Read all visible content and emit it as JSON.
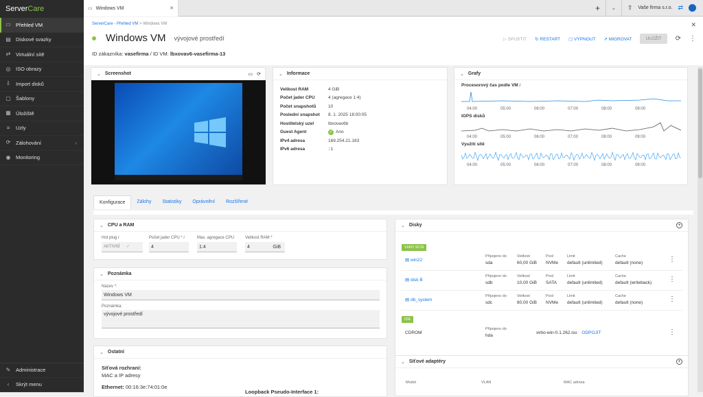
{
  "brand": {
    "part1": "Server",
    "part2": "Care"
  },
  "sidebar": {
    "items": [
      {
        "label": "Přehled VM",
        "icon": "monitor-icon"
      },
      {
        "label": "Diskové svazky",
        "icon": "disk-icon"
      },
      {
        "label": "Virtuální sítě",
        "icon": "network-icon"
      },
      {
        "label": "ISO obrazy",
        "icon": "iso-icon"
      },
      {
        "label": "Import disků",
        "icon": "import-icon"
      },
      {
        "label": "Šablony",
        "icon": "template-icon"
      },
      {
        "label": "Úložiště",
        "icon": "storage-icon"
      },
      {
        "label": "Uzly",
        "icon": "nodes-icon"
      },
      {
        "label": "Zálohování",
        "icon": "backup-icon"
      },
      {
        "label": "Monitoring",
        "icon": "monitoring-icon"
      }
    ],
    "bottom": [
      {
        "label": "Administrace",
        "icon": "wrench-icon"
      },
      {
        "label": "Skrýt menu",
        "icon": "chevron-left-icon"
      }
    ]
  },
  "topbar": {
    "tab_label": "Windows VM",
    "company": "Vaše firma s.r.o."
  },
  "header": {
    "breadcrumb_root": "ServerCare - Přehled VM",
    "breadcrumb_current": "Windows VM",
    "vm_name": "Windows VM",
    "vm_desc": "vývojové prostředí",
    "actions": {
      "start": "SPUSTIT",
      "restart": "RESTART",
      "stop": "VYPNOUT",
      "migrate": "MIGROVAT",
      "save": "ULOŽIT"
    },
    "id_label": "ID zákazníka:",
    "customer_id": "vasefirma",
    "vm_id_label": "ID VM:",
    "vm_id": "lbxovav6-vasefirma-13"
  },
  "screenshot_panel": {
    "title": "Screenshot"
  },
  "info_panel": {
    "title": "Informace",
    "rows": [
      {
        "k": "Velikost RAM",
        "v": "4 GiB"
      },
      {
        "k": "Počet jader CPU",
        "v": "4  (agregace  1:4)"
      },
      {
        "k": "Počet snapshotů",
        "v": "10"
      },
      {
        "k": "Poslední snapshot",
        "v": "8. 1. 2025 18:00:05"
      },
      {
        "k": "Hostitelský uzel",
        "v": "lbxovav6b"
      },
      {
        "k": "Guest Agent",
        "v": "Ano"
      },
      {
        "k": "IPv4 adresa",
        "v": "169.254.21.183"
      },
      {
        "k": "IPv6 adresa",
        "v": "::1"
      }
    ]
  },
  "graphs_panel": {
    "title": "Grafy",
    "charts": [
      {
        "title": "Procesorový čas podle VM"
      },
      {
        "title": "IOPS disků"
      },
      {
        "title": "Využití sítě"
      }
    ],
    "x_ticks": [
      "04:00",
      "05:00",
      "06:00",
      "07:00",
      "08:00",
      "09:00"
    ]
  },
  "tabs": [
    "Konfigurace",
    "Zálohy",
    "Statistiky",
    "Oprávnění",
    "Rozšířené"
  ],
  "cpu_panel": {
    "title": "CPU a RAM",
    "hotplug_label": "Hot plug",
    "hotplug_value": "AKTIVNÍ",
    "cores_label": "Počet jader CPU",
    "cores_value": "4",
    "agg_label": "Max. agregace CPU",
    "agg_value": "1:4",
    "ram_label": "Velikost RAM",
    "ram_value": "4",
    "ram_unit": "GiB"
  },
  "note_panel": {
    "title": "Poznámka",
    "name_label": "Název",
    "name_value": "Windows VM",
    "note_label": "Poznámka:",
    "note_value": "vývojové prostředí"
  },
  "other_panel": {
    "title": "Ostatní",
    "net_label": "Síťová rozhraní:",
    "net_sub": "MAC a IP adresy",
    "eth_label": "Ethernet:",
    "eth_mac": "00:16:3e:74:01:0e",
    "loop_label": "Loopback Pseudo-Interface 1:"
  },
  "disks_panel": {
    "title": "Disky",
    "scsi_badge": "VirtIO SCSI",
    "ide_badge": "IDE",
    "col_attached": "Připojeno do",
    "col_size": "Velikost",
    "col_pool": "Pool",
    "col_limit": "Limit",
    "col_cache": "Cache",
    "disks": [
      {
        "name": "win22",
        "attached": "sda",
        "size": "60,00 GiB",
        "pool": "NVMe",
        "limit": "default (unlimited)",
        "cache": "default (none)"
      },
      {
        "name": "disk B",
        "attached": "sdb",
        "size": "10,00 GiB",
        "pool": "SATA",
        "limit": "default (unlimited)",
        "cache": "default (writeback)"
      },
      {
        "name": "db_system",
        "attached": "sdc",
        "size": "80,00 GiB",
        "pool": "NVMe",
        "limit": "default (unlimited)",
        "cache": "default (none)"
      }
    ],
    "cdrom": {
      "name": "CDROM",
      "attached": "hda",
      "iso": "virtio-win-0.1.262.iso",
      "action": "ODPOJIT"
    }
  },
  "nic_panel": {
    "title": "Síťové adaptéry",
    "col_model": "Model",
    "col_vlan": "VLAN",
    "col_mac": "MAC adresa"
  }
}
